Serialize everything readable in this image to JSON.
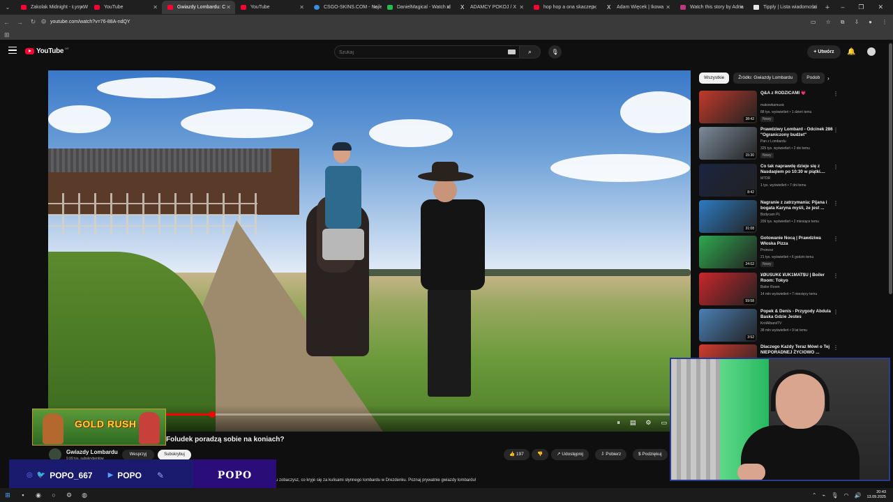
{
  "browser": {
    "tabs": [
      {
        "label": "Zakolak Midnight - Łysy W",
        "active": false,
        "icon": "youtube-icon"
      },
      {
        "label": "YouTube",
        "active": false,
        "icon": "youtube-icon"
      },
      {
        "label": "Gwiazdy Lombardu: C",
        "active": true,
        "icon": "youtube-icon"
      },
      {
        "label": "YouTube",
        "active": false,
        "icon": "youtube-icon"
      },
      {
        "label": "CSGO-SKINS.COM - Najle",
        "active": false,
        "icon": "csgo-icon"
      },
      {
        "label": "DanielMagical - Watch cl",
        "active": false,
        "icon": "daniel-icon"
      },
      {
        "label": "ADAMCY POKOJ / X",
        "active": false,
        "icon": "x-icon"
      },
      {
        "label": "hop hop a ona skaczep",
        "active": false,
        "icon": "youtube-icon"
      },
      {
        "label": "Adam Więcek | Ikowa",
        "active": false,
        "icon": "x-icon"
      },
      {
        "label": "Watch this story by Adria",
        "active": false,
        "icon": "instagram-icon"
      },
      {
        "label": "Tipply | Lista wiadomości",
        "active": false,
        "icon": "tipply-icon"
      }
    ],
    "url": "youtube.com/watch?v=76-88A-ndQY"
  },
  "header": {
    "logo_text": "YouTube",
    "logo_region": "MT",
    "search_placeholder": "Szukaj",
    "create_label": "Utwórz"
  },
  "player": {
    "progress": 0.25
  },
  "video": {
    "title": "Foludek poradzą sobie na koniach?",
    "channel": "Gwiazdy Lombardu",
    "subscribers": "9,99 tys. subskrybentów",
    "support_label": "Wesprzyj",
    "subscribe_label": "Subskrybuj",
    "likes": "197",
    "share_label": "Udostępnij",
    "download_label": "Pobierz",
    "thanks_label": "Podziękuj",
    "description": "u zobaczysz, co kryje się za kulisami słynnego lombardu w Drezdenku. Poznaj prywatnie gwiazdy lombardu!"
  },
  "sidebar": {
    "chips": [
      "Wszystkie",
      "Źródło: Gwiazdy Lombardu",
      "Podob"
    ],
    "recommendations": [
      {
        "title": "Q&A z RODZICAMI 💗",
        "channel": "makowkamusic",
        "meta": "88 tys. wyświetleń • 1 dzień temu",
        "badge": "Nowy",
        "duration": "38:42",
        "color": "#c0392b"
      },
      {
        "title": "Prawdziwy Lombard - Odcinek 286 \"Ograniczony budżet\"",
        "channel": "Pan z Lombardu",
        "meta": "325 tys. wyświetleń • 2 dni temu",
        "badge": "Nowy",
        "duration": "15:30",
        "color": "#7b8a9a"
      },
      {
        "title": "Co tak naprawdę dzieje się z Nasdaqiem po 10:30 w piątki....",
        "channel": "M7DR",
        "meta": "1 tys. wyświetleń • 7 dni temu",
        "badge": "",
        "duration": "8:42",
        "color": "#1b2440"
      },
      {
        "title": "Nagranie z zatrzymania: Pijana i bogata Karyna myśli, że jest ...",
        "channel": "Bodycam PL",
        "meta": "209 tys. wyświetleń • 2 miesiące temu",
        "badge": "",
        "duration": "31:08",
        "color": "#2d7bc2"
      },
      {
        "title": "Gotowanie Nocą | Prawdziwa Włoska Pizza",
        "channel": "Pronosz",
        "meta": "21 tys. wyświetleń • 6 godzin temu",
        "badge": "Nowy",
        "duration": "24:02",
        "color": "#2fa84f"
      },
      {
        "title": "¥ØUŠUK€ ¥UK1MAT$U | Boiler Room: Tokyo",
        "channel": "Boiler Room",
        "meta": "14 mln wyświetleń • 7 miesięcy temu",
        "badge": "",
        "duration": "59:58",
        "color": "#c9262b"
      },
      {
        "title": "Popek & Denis - Przygody Abdula Baska Gdzie Jestes",
        "channel": "KrólAlbaniiTV",
        "meta": "38 mln wyświetleń • 9 lat temu",
        "badge": "",
        "duration": "3:52",
        "color": "#4a7fb5"
      },
      {
        "title": "Dlaczego Każdy Teraz Mówi o Tej NIEPORADNEJ ŻYCIOWO ...",
        "channel": "",
        "meta": "",
        "badge": "",
        "duration": "",
        "color": "#d23b2f"
      }
    ]
  },
  "overlays": {
    "game_banner": "GOLD RUSH",
    "social_handle": "POPO_667",
    "social_youtube": "POPO",
    "brand": "POPO"
  },
  "taskbar": {
    "time": "20:43",
    "date": "13.09.2025"
  }
}
